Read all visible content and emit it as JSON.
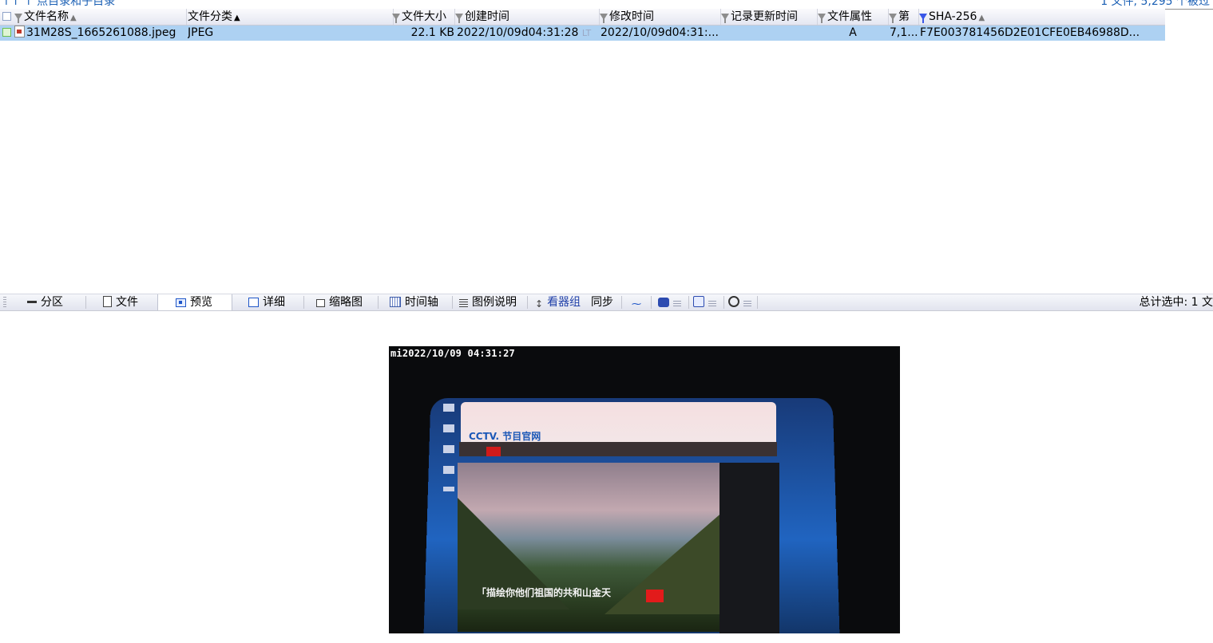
{
  "top_strip": {
    "left_text": "↑↑ ↑ 点目录和子目录",
    "right_text": "1 文件, 5,295 个被过"
  },
  "columns": [
    {
      "label": "文件名称",
      "filter": false,
      "sort": "asc-light"
    },
    {
      "label": "文件分类",
      "filter": false,
      "sort": "asc"
    },
    {
      "label": "文件大小",
      "filter": true
    },
    {
      "label": "创建时间",
      "filter": true
    },
    {
      "label": "修改时间",
      "filter": true
    },
    {
      "label": "记录更新时间",
      "filter": true
    },
    {
      "label": "文件属性",
      "filter": true
    },
    {
      "label": "第",
      "filter": true
    },
    {
      "label": "SHA-256",
      "filter": true,
      "filter_active": true
    }
  ],
  "row": {
    "name": "31M28S_1665261088.jpeg",
    "type": "JPEG",
    "size": "22.1 KB",
    "created": "2022/10/09d04:31:28",
    "created_suffix": "LT",
    "modified": "2022/10/09d04:31:...",
    "record_updated": "",
    "attr": "A",
    "first": "7,1...",
    "sha256": "F7E003781456D2E01CFE0EB46988D..."
  },
  "toolbar": {
    "partition": "分区",
    "file": "文件",
    "preview": "预览",
    "details": "详细",
    "thumbnails": "缩略图",
    "timeline": "时间轴",
    "legend": "图例说明",
    "viewer_group": "看器组",
    "sync": "同步",
    "status": "总计选中: 1 文"
  },
  "preview": {
    "timestamp": "mi2022/10/09  04:31:27",
    "brand": "CCTV. 节目官网",
    "subtitle": "「描绘你他们祖国的共和山金天"
  }
}
